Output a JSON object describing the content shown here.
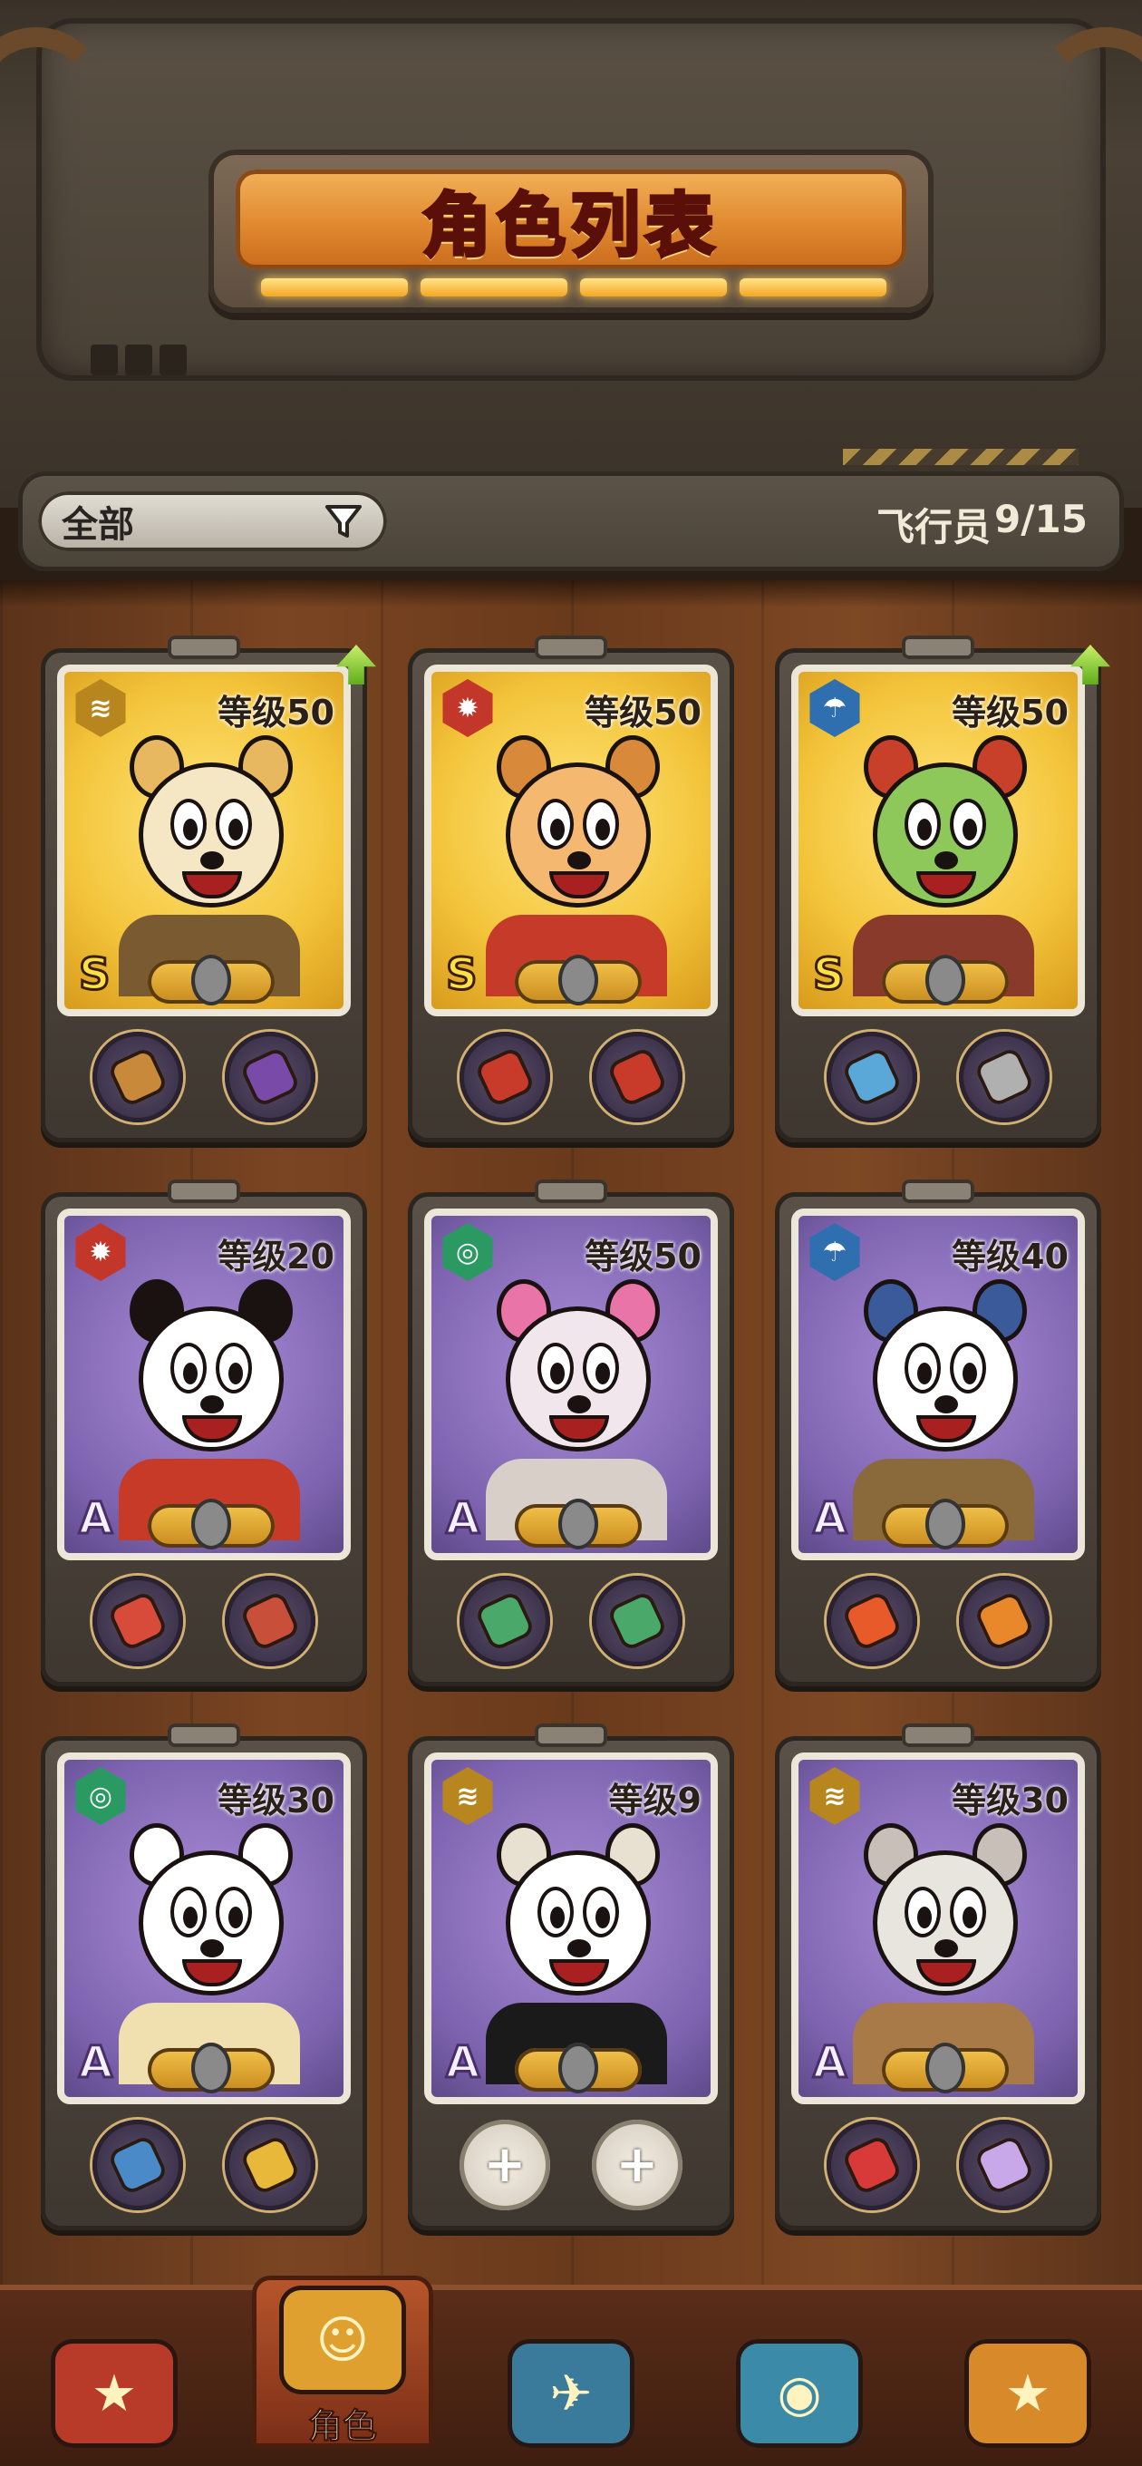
{
  "header": {
    "title": "角色列表"
  },
  "filter": {
    "label": "全部",
    "pilot_label": "飞行员",
    "pilot_count": "9/15"
  },
  "cards": [
    {
      "level": "等级50",
      "rank": "S",
      "element": "wind",
      "bg": "gold",
      "upgrade": true,
      "slots": [
        "drill-gear",
        "helmet-gear"
      ]
    },
    {
      "level": "等级50",
      "rank": "S",
      "element": "fire",
      "bg": "gold",
      "upgrade": false,
      "slots": [
        "bomb-gear",
        "bomb-gear"
      ]
    },
    {
      "level": "等级50",
      "rank": "S",
      "element": "rain",
      "bg": "gold",
      "upgrade": true,
      "slots": [
        "eye-gear",
        "cannon-gear"
      ]
    },
    {
      "level": "等级20",
      "rank": "A",
      "element": "fire",
      "bg": "purple",
      "upgrade": false,
      "slots": [
        "rocket-gear",
        "blaster-gear"
      ]
    },
    {
      "level": "等级50",
      "rank": "A",
      "element": "vortex",
      "bg": "purple",
      "upgrade": false,
      "slots": [
        "magnet-gear",
        "magnet-gear"
      ]
    },
    {
      "level": "等级40",
      "rank": "A",
      "element": "rain",
      "bg": "purple",
      "upgrade": false,
      "slots": [
        "missile-gear",
        "spring-gear"
      ]
    },
    {
      "level": "等级30",
      "rank": "A",
      "element": "vortex",
      "bg": "purple",
      "upgrade": false,
      "slots": [
        "ring-gear",
        "coin-gear"
      ]
    },
    {
      "level": "等级9",
      "rank": "A",
      "element": "wind",
      "bg": "purple",
      "upgrade": false,
      "slots": [
        "empty",
        "empty"
      ]
    },
    {
      "level": "等级30",
      "rank": "A",
      "element": "wind",
      "bg": "purple",
      "upgrade": false,
      "slots": [
        "mushroom-gear",
        "wing-gear"
      ]
    }
  ],
  "empty_slot_symbol": "+",
  "nav": [
    {
      "icon": "star-chest-icon",
      "label": ""
    },
    {
      "icon": "character-icon",
      "label": "角色"
    },
    {
      "icon": "airship-icon",
      "label": ""
    },
    {
      "icon": "goggles-icon",
      "label": ""
    },
    {
      "icon": "star-book-icon",
      "label": ""
    }
  ],
  "colors": {
    "accent": "#e08a30",
    "title_text": "#c8281c",
    "rank_s": "#ffe046",
    "wood": "#7a4522"
  }
}
